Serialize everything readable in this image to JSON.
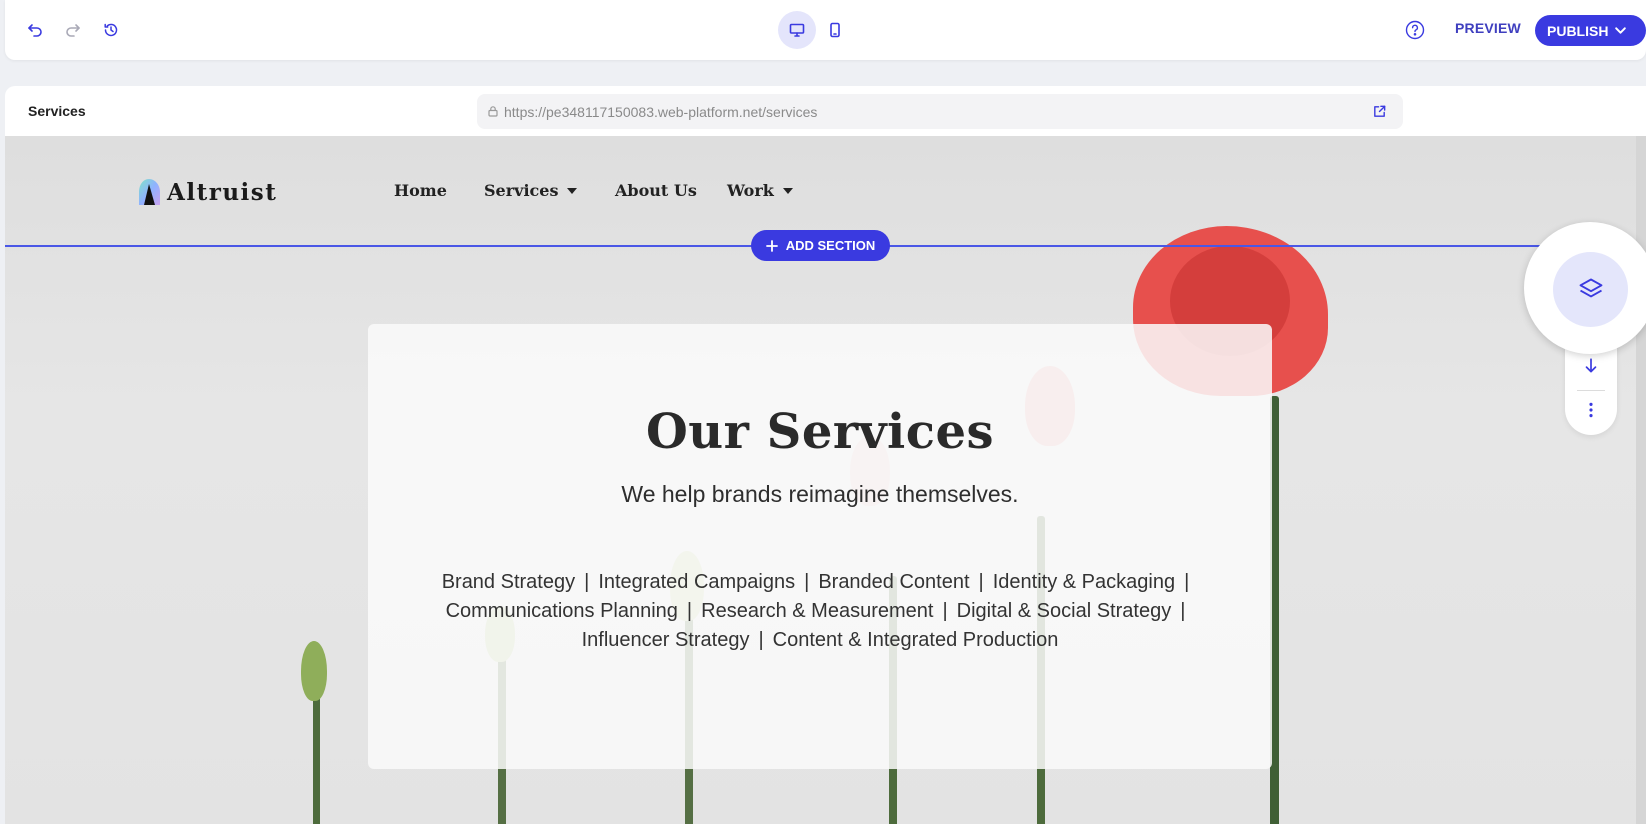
{
  "toolbar": {
    "undo_icon": "undo-icon",
    "redo_icon": "redo-icon",
    "history_icon": "history-icon",
    "desktop_icon": "desktop-icon",
    "mobile_icon": "mobile-icon",
    "help_icon": "help-icon",
    "preview_label": "PREVIEW",
    "publish_label": "PUBLISH"
  },
  "frame": {
    "page_name": "Services",
    "url": "https://pe348117150083.web-platform.net/services"
  },
  "editor": {
    "add_section_label": "ADD SECTION"
  },
  "site": {
    "logo_text": "Altruist",
    "nav": [
      {
        "label": "Home",
        "has_dropdown": false
      },
      {
        "label": "Services",
        "has_dropdown": true
      },
      {
        "label": "About Us",
        "has_dropdown": false
      },
      {
        "label": "Work",
        "has_dropdown": true
      }
    ],
    "hero": {
      "title": "Our Services",
      "subtitle": "We help brands reimagine themselves.",
      "services": [
        "Brand Strategy",
        "Integrated Campaigns",
        "Branded Content",
        "Identity & Packaging",
        "Communications Planning",
        "Research & Measurement",
        "Digital & Social Strategy",
        "Influencer Strategy",
        "Content & Integrated Production"
      ]
    }
  },
  "colors": {
    "accent": "#3a3ae0",
    "section_line": "#4a57e6",
    "layers_bg": "#e4e6fb"
  }
}
